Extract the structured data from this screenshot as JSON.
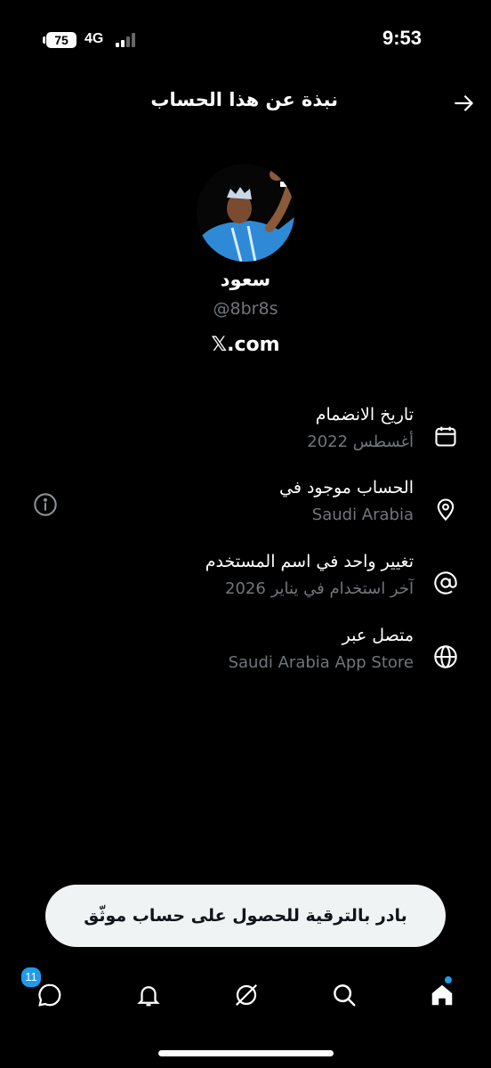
{
  "status": {
    "time": "9:53",
    "battery": "75",
    "network": "4G"
  },
  "header": {
    "title": "نبذة عن هذا الحساب"
  },
  "profile": {
    "name": "سعود",
    "handle": "@8br8s",
    "site": "𝕏.com"
  },
  "info": [
    {
      "icon": "calendar-icon",
      "title": "تاريخ الانضمام",
      "sub": "أغسطس 2022"
    },
    {
      "icon": "location-pin-icon",
      "title": "الحساب موجود في",
      "sub": "Saudi Arabia"
    },
    {
      "icon": "at-sign-icon",
      "title": "تغيير واحد في اسم المستخدم",
      "sub": "آخر استخدام في يناير 2026"
    },
    {
      "icon": "globe-icon",
      "title": "متصل عبر",
      "sub": "Saudi Arabia App Store"
    }
  ],
  "upgrade": {
    "label": "بادر بالترقية للحصول على حساب موثّق"
  },
  "tabbar": {
    "messages_badge": "11"
  },
  "colors": {
    "background": "#000000",
    "secondary_text": "#71767b",
    "accent": "#1d9bf0",
    "button_bg": "#eff3f4"
  }
}
